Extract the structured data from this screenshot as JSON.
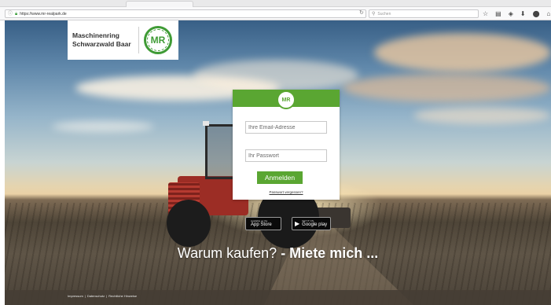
{
  "browser": {
    "url": "https://www.mr-realpark.de",
    "search_placeholder": "Suchen",
    "toolbar_icons": [
      "star-icon",
      "library-icon",
      "pocket-icon",
      "download-icon",
      "sync-icon",
      "home-icon",
      "more-icon"
    ]
  },
  "logo": {
    "line1": "Maschinenring",
    "line2": "Schwarzwald Baar",
    "mark": "MR",
    "brand_color": "#3f9b35"
  },
  "login": {
    "badge": "MR",
    "email_placeholder": "Ihre Email-Adresse",
    "password_placeholder": "Ihr Passwort",
    "submit_label": "Anmelden",
    "forgot_label": "Passwort vergessen?",
    "accent_color": "#5aa632"
  },
  "stores": {
    "apple_small": "Available on the",
    "apple_big": "App Store",
    "google_small": "GET IT ON",
    "google_big": "Google play"
  },
  "headline": {
    "regular": "Warum kaufen?",
    "bold": "- Miete mich ..."
  },
  "footer": {
    "links": [
      "Impressum",
      "Datenschutz",
      "Rechtliche Hinweise"
    ],
    "separator": " | "
  }
}
